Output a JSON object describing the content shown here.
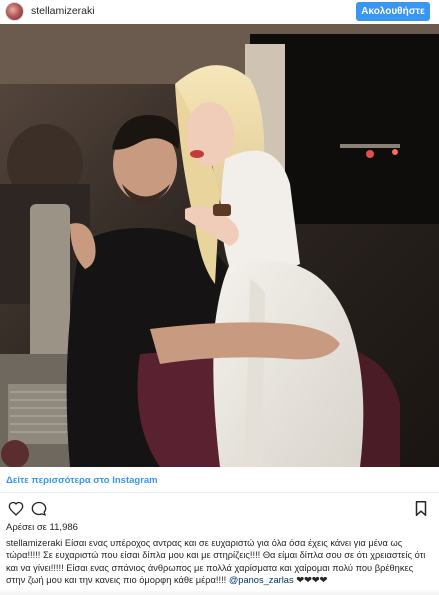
{
  "header": {
    "username": "stellamizeraki",
    "follow_label": "Ακολουθήστε"
  },
  "photo": {
    "description_icon": "photo"
  },
  "view_more": "Δείτε περισσότερα στο Instagram",
  "actions": {
    "like_icon": "heart-icon",
    "comment_icon": "comment-icon",
    "save_icon": "bookmark-icon"
  },
  "likes": "Αρέσει σε 11,986",
  "caption": {
    "user": "stellamizeraki",
    "text": " Είσαι ενας υπέροχος αντρας και σε ευχαριστώ για όλα όσα έχεις κάνει για μένα ως τώρα!!!!! Σε ευχαριστώ που είσαι δίπλα μου και με στηρίζεις!!!! Θα είμαι δίπλα σου σε ότι χρειαστείς ότι και να γίνει!!!!! Είσαι ενας σπάνιος άνθρωπος με πολλά χαρίσματα και χαίρομαι πολύ που βρέθηκες στην ζωή μου και την κανεις πιο όμορφη κάθε μέρα!!!! ",
    "mention": "@panos_zarlas",
    "hearts": " ❤❤❤❤"
  },
  "colors": {
    "accent": "#3897f0",
    "link": "#3897f0",
    "text": "#262626"
  }
}
